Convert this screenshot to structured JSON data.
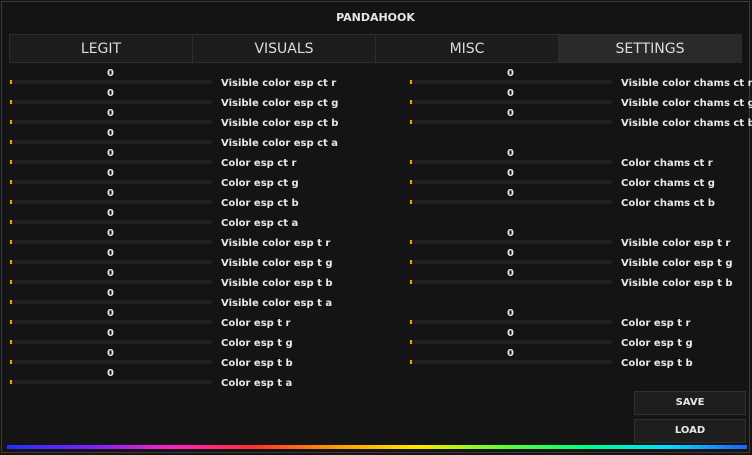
{
  "window": {
    "title": "PANDAHOOK"
  },
  "tabs": [
    {
      "label": "LEGIT"
    },
    {
      "label": "VISUALS"
    },
    {
      "label": "MISC"
    },
    {
      "label": "SETTINGS"
    }
  ],
  "left_rows": [
    {
      "value": "0",
      "label": "Visible color esp ct r"
    },
    {
      "value": "0",
      "label": "Visible color esp ct g"
    },
    {
      "value": "0",
      "label": "Visible color esp ct b"
    },
    {
      "value": "0",
      "label": "Visible color esp ct a"
    },
    {
      "value": "0",
      "label": "Color esp ct r"
    },
    {
      "value": "0",
      "label": "Color esp ct g"
    },
    {
      "value": "0",
      "label": "Color esp ct b"
    },
    {
      "value": "0",
      "label": "Color esp ct a"
    },
    {
      "value": "0",
      "label": "Visible color esp t r"
    },
    {
      "value": "0",
      "label": "Visible color esp t g"
    },
    {
      "value": "0",
      "label": "Visible color esp t b"
    },
    {
      "value": "0",
      "label": "Visible color esp t a"
    },
    {
      "value": "0",
      "label": "Color esp t r"
    },
    {
      "value": "0",
      "label": "Color esp t g"
    },
    {
      "value": "0",
      "label": "Color esp t b"
    },
    {
      "value": "0",
      "label": "Color esp t a"
    }
  ],
  "right_rows": [
    {
      "value": "0",
      "label": "Visible color chams ct r"
    },
    {
      "value": "0",
      "label": "Visible color chams ct g"
    },
    {
      "value": "0",
      "label": "Visible color chams ct b"
    },
    null,
    {
      "value": "0",
      "label": "Color chams ct r"
    },
    {
      "value": "0",
      "label": "Color chams ct g"
    },
    {
      "value": "0",
      "label": "Color chams ct b"
    },
    null,
    {
      "value": "0",
      "label": "Visible color esp t r"
    },
    {
      "value": "0",
      "label": "Visible color esp t g"
    },
    {
      "value": "0",
      "label": "Visible color esp t b"
    },
    null,
    {
      "value": "0",
      "label": "Color esp t r"
    },
    {
      "value": "0",
      "label": "Color esp t g"
    },
    {
      "value": "0",
      "label": "Color esp t b"
    }
  ],
  "buttons": {
    "save": "SAVE",
    "load": "LOAD"
  },
  "colors": {
    "accent": "#ff9a00",
    "background": "#141414",
    "panel": "#1d1d1d",
    "text": "#e8e8e8"
  }
}
